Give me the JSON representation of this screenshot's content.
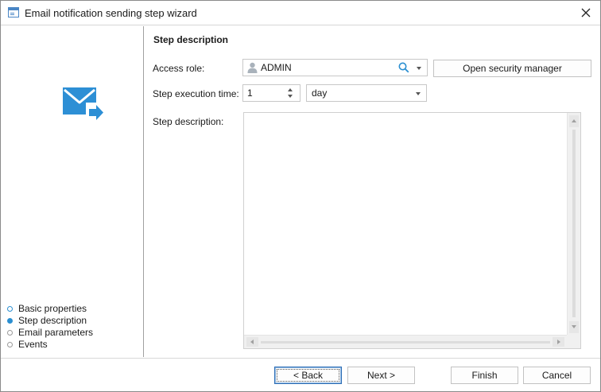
{
  "window": {
    "title": "Email notification sending step wizard"
  },
  "sidebar": {
    "steps": [
      {
        "label": "Basic properties",
        "state": "done"
      },
      {
        "label": "Step description",
        "state": "active"
      },
      {
        "label": "Email parameters",
        "state": "pending"
      },
      {
        "label": "Events",
        "state": "pending"
      }
    ]
  },
  "main": {
    "section_title": "Step description",
    "access_role": {
      "label": "Access role:",
      "value": "ADMIN"
    },
    "open_security_manager_label": "Open security manager",
    "execution_time": {
      "label": "Step execution time:",
      "amount": "1",
      "unit": "day"
    },
    "description": {
      "label": "Step description:",
      "value": ""
    }
  },
  "footer": {
    "back_label": "< Back",
    "next_label": "Next >",
    "finish_label": "Finish",
    "cancel_label": "Cancel"
  },
  "colors": {
    "accent": "#2b8fd1",
    "mail_icon": "#2d8fd5"
  }
}
